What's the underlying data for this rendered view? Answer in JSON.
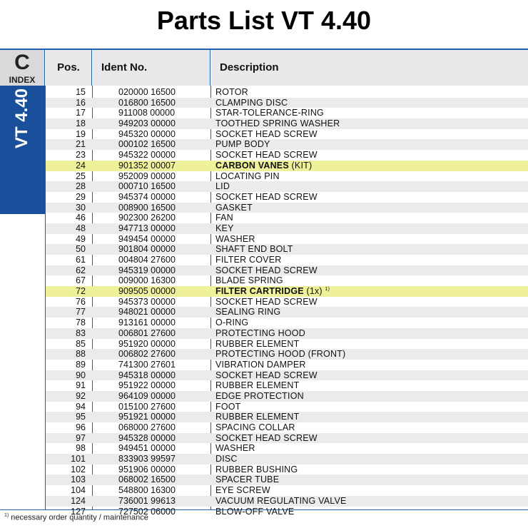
{
  "title": "Parts List VT 4.40",
  "index": {
    "letter": "C",
    "label": "INDEX"
  },
  "side_label": "VT 4.40",
  "columns": {
    "pos": "Pos.",
    "ident": "Ident No.",
    "desc": "Description"
  },
  "rows": [
    {
      "pos": "15",
      "ident": "020000 16500",
      "desc": "ROTOR",
      "extra": "",
      "note": "",
      "hl": false
    },
    {
      "pos": "16",
      "ident": "016800 16500",
      "desc": "CLAMPING DISC",
      "extra": "",
      "note": "",
      "hl": false
    },
    {
      "pos": "17",
      "ident": "911008 00000",
      "desc": "STAR-TOLERANCE-RING",
      "extra": "",
      "note": "",
      "hl": false
    },
    {
      "pos": "18",
      "ident": "949203 00000",
      "desc": "TOOTHED SPRING WASHER",
      "extra": "",
      "note": "",
      "hl": false
    },
    {
      "pos": "19",
      "ident": "945320 00000",
      "desc": "SOCKET HEAD SCREW",
      "extra": "",
      "note": "",
      "hl": false
    },
    {
      "pos": "21",
      "ident": "000102 16500",
      "desc": "PUMP BODY",
      "extra": "",
      "note": "",
      "hl": false
    },
    {
      "pos": "23",
      "ident": "945322 00000",
      "desc": "SOCKET HEAD SCREW",
      "extra": "",
      "note": "",
      "hl": false
    },
    {
      "pos": "24",
      "ident": "901352 00007",
      "desc": "CARBON VANES",
      "extra": " (KIT)",
      "note": "",
      "hl": true
    },
    {
      "pos": "25",
      "ident": "952009 00000",
      "desc": "LOCATING PIN",
      "extra": "",
      "note": "",
      "hl": false
    },
    {
      "pos": "28",
      "ident": "000710 16500",
      "desc": "LID",
      "extra": "",
      "note": "",
      "hl": false
    },
    {
      "pos": "29",
      "ident": "945374 00000",
      "desc": "SOCKET HEAD SCREW",
      "extra": "",
      "note": "",
      "hl": false
    },
    {
      "pos": "30",
      "ident": "008900 16500",
      "desc": "GASKET",
      "extra": "",
      "note": "",
      "hl": false
    },
    {
      "pos": "46",
      "ident": "902300 26200",
      "desc": "FAN",
      "extra": "",
      "note": "",
      "hl": false
    },
    {
      "pos": "48",
      "ident": "947713 00000",
      "desc": "KEY",
      "extra": "",
      "note": "",
      "hl": false
    },
    {
      "pos": "49",
      "ident": "949454 00000",
      "desc": "WASHER",
      "extra": "",
      "note": "",
      "hl": false
    },
    {
      "pos": "50",
      "ident": "901804 00000",
      "desc": "SHAFT END BOLT",
      "extra": "",
      "note": "",
      "hl": false
    },
    {
      "pos": "61",
      "ident": "004804 27600",
      "desc": "FILTER COVER",
      "extra": "",
      "note": "",
      "hl": false
    },
    {
      "pos": "62",
      "ident": "945319 00000",
      "desc": "SOCKET HEAD SCREW",
      "extra": "",
      "note": "",
      "hl": false
    },
    {
      "pos": "67",
      "ident": "009000 16300",
      "desc": "BLADE SPRING",
      "extra": "",
      "note": "",
      "hl": false
    },
    {
      "pos": "72",
      "ident": "909505 00000",
      "desc": "FILTER CARTRIDGE",
      "extra": " (1x)",
      "note": "1)",
      "hl": true
    },
    {
      "pos": "76",
      "ident": "945373 00000",
      "desc": "SOCKET HEAD SCREW",
      "extra": "",
      "note": "",
      "hl": false
    },
    {
      "pos": "77",
      "ident": "948021 00000",
      "desc": "SEALING RING",
      "extra": "",
      "note": "",
      "hl": false
    },
    {
      "pos": "78",
      "ident": "913161 00000",
      "desc": "O-RING",
      "extra": "",
      "note": "",
      "hl": false
    },
    {
      "pos": "83",
      "ident": "006801 27600",
      "desc": "PROTECTING HOOD",
      "extra": "",
      "note": "",
      "hl": false
    },
    {
      "pos": "85",
      "ident": "951920 00000",
      "desc": "RUBBER ELEMENT",
      "extra": "",
      "note": "",
      "hl": false
    },
    {
      "pos": "88",
      "ident": "006802 27600",
      "desc": "PROTECTING HOOD (FRONT)",
      "extra": "",
      "note": "",
      "hl": false
    },
    {
      "pos": "89",
      "ident": "741300 27601",
      "desc": "VIBRATION DAMPER",
      "extra": "",
      "note": "",
      "hl": false
    },
    {
      "pos": "90",
      "ident": "945318 00000",
      "desc": "SOCKET HEAD SCREW",
      "extra": "",
      "note": "",
      "hl": false
    },
    {
      "pos": "91",
      "ident": "951922 00000",
      "desc": "RUBBER ELEMENT",
      "extra": "",
      "note": "",
      "hl": false
    },
    {
      "pos": "92",
      "ident": "964109 00000",
      "desc": "EDGE PROTECTION",
      "extra": "",
      "note": "",
      "hl": false
    },
    {
      "pos": "94",
      "ident": "015100 27600",
      "desc": "FOOT",
      "extra": "",
      "note": "",
      "hl": false
    },
    {
      "pos": "95",
      "ident": "951921 00000",
      "desc": "RUBBER ELEMENT",
      "extra": "",
      "note": "",
      "hl": false
    },
    {
      "pos": "96",
      "ident": "068000 27600",
      "desc": "SPACING COLLAR",
      "extra": "",
      "note": "",
      "hl": false
    },
    {
      "pos": "97",
      "ident": "945328 00000",
      "desc": "SOCKET HEAD SCREW",
      "extra": "",
      "note": "",
      "hl": false
    },
    {
      "pos": "98",
      "ident": "949451 00000",
      "desc": "WASHER",
      "extra": "",
      "note": "",
      "hl": false
    },
    {
      "pos": "101",
      "ident": "833903 99597",
      "desc": "DISC",
      "extra": "",
      "note": "",
      "hl": false
    },
    {
      "pos": "102",
      "ident": "951906 00000",
      "desc": "RUBBER BUSHING",
      "extra": "",
      "note": "",
      "hl": false
    },
    {
      "pos": "103",
      "ident": "068002 16500",
      "desc": "SPACER TUBE",
      "extra": "",
      "note": "",
      "hl": false
    },
    {
      "pos": "104",
      "ident": "548800 16300",
      "desc": "EYE SCREW",
      "extra": "",
      "note": "",
      "hl": false
    },
    {
      "pos": "124",
      "ident": "736001 99613",
      "desc": "VACUUM REGULATING VALVE",
      "extra": "",
      "note": "",
      "hl": false
    },
    {
      "pos": "127",
      "ident": "727502 06000",
      "desc": "BLOW-OFF VALVE",
      "extra": "",
      "note": "",
      "hl": false
    }
  ],
  "footnote": {
    "mark": "1)",
    "text": " necessary order quantity / maintenance"
  },
  "colors": {
    "accent": "#1a4f9c",
    "highlight": "#eef09a",
    "stripe": "#ebebeb"
  }
}
